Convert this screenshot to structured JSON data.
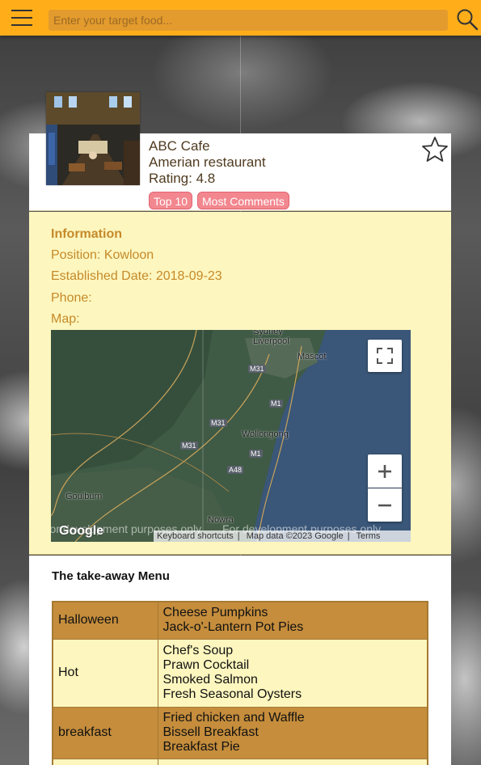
{
  "search": {
    "placeholder": "Enter your target food..."
  },
  "icons": {
    "menu": "hamburger-menu-icon",
    "search": "search-icon",
    "favorite": "star-outline-icon"
  },
  "colors": {
    "topbar": "#ffae1a",
    "tag": "#f3878f",
    "info_bg": "#fdf6be",
    "info_text": "#c58a2a",
    "table_dark": "#c58d3c"
  },
  "restaurant": {
    "name": "ABC Cafe",
    "type": "Amerian restaurant",
    "rating": "Rating: 4.8",
    "tags": [
      "Top 10",
      "Most Comments"
    ]
  },
  "info": {
    "title": "Information",
    "position": "Position: Kowloon",
    "established": "Established Date: 2018-09-23",
    "phone": "Phone:",
    "map_label": "Map:"
  },
  "map": {
    "places": [
      "Sydney",
      "Liverpool",
      "Mascot",
      "Wollongong",
      "Goulburn",
      "Nowra"
    ],
    "roads": [
      "M31",
      "M1",
      "M31",
      "M31",
      "M1",
      "A48"
    ],
    "watermark": "For development purposes only",
    "attribution": [
      "Keyboard shortcuts",
      "Map data ©2023 Google",
      "Terms"
    ],
    "logo": "Google"
  },
  "menu": {
    "title": "The take-away Menu",
    "rows": [
      {
        "category": "Halloween",
        "items": [
          "Cheese Pumpkins",
          "Jack-o'-Lantern Pot Pies"
        ]
      },
      {
        "category": "Hot",
        "items": [
          "Chef's Soup",
          "Prawn Cocktail",
          "Smoked Salmon",
          "Fresh Seasonal Oysters"
        ]
      },
      {
        "category": "breakfast",
        "items": [
          "Fried chicken and Waffle",
          "Bissell Breakfast",
          "Breakfast Pie"
        ]
      }
    ]
  }
}
